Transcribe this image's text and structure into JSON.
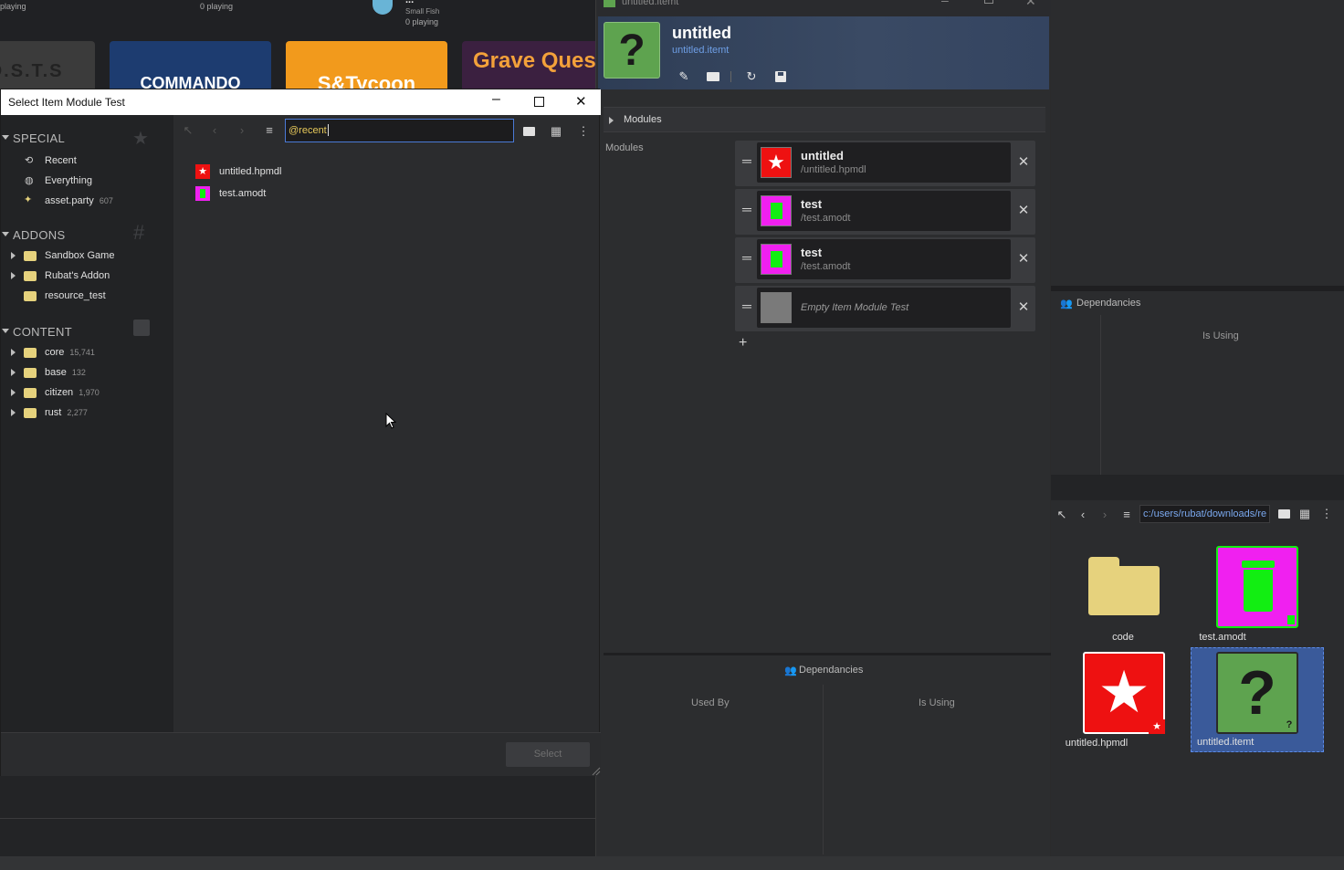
{
  "game_browser": {
    "playing_left": "playing",
    "playing_mid": "0 playing",
    "featured_title": "...",
    "featured_author": "Small Fish",
    "featured_players": "0 playing",
    "cards": [
      "G.O.S.T.S",
      "COMMANDO",
      "S&Tycoon",
      "Grave Ques"
    ]
  },
  "item_editor": {
    "window_title": "untitled.itemt",
    "asset_name": "untitled",
    "asset_path": "untitled.itemt",
    "toolbar": [
      "pencil-icon",
      "folder-icon",
      "refresh-icon",
      "save-icon"
    ],
    "modules_section": "Modules",
    "modules_label": "Modules",
    "modules": [
      {
        "title": "untitled",
        "sub": "/untitled.hpmdl",
        "thumb": "star"
      },
      {
        "title": "test",
        "sub": "/test.amodt",
        "thumb": "trash"
      },
      {
        "title": "test",
        "sub": "/test.amodt",
        "thumb": "trash"
      },
      {
        "title": "Empty Item Module Test",
        "sub": "",
        "thumb": "empty"
      }
    ],
    "add_symbol": "+",
    "dependencies": {
      "title": "Dependancies",
      "used_by": "Used By",
      "is_using": "Is Using"
    }
  },
  "right_panel": {
    "dependencies": {
      "title": "Dependancies",
      "is_using": "Is Using"
    },
    "path": "c:/users/rubat/downloads/re",
    "tiles": [
      {
        "label": "code",
        "kind": "folder"
      },
      {
        "label": "test.amodt",
        "kind": "trash"
      },
      {
        "label": "untitled.hpmdl",
        "kind": "star"
      },
      {
        "label": "untitled.itemt",
        "kind": "question"
      }
    ]
  },
  "dialog": {
    "title": "Select Item Module Test",
    "search_value": "@recent",
    "sections": {
      "special": {
        "heading": "SPECIAL",
        "items": [
          {
            "label": "Recent",
            "count": ""
          },
          {
            "label": "Everything",
            "count": ""
          },
          {
            "label": "asset.party",
            "count": "607"
          }
        ]
      },
      "addons": {
        "heading": "ADDONS",
        "items": [
          {
            "label": "Sandbox Game"
          },
          {
            "label": "Rubat's Addon"
          },
          {
            "label": "resource_test"
          }
        ]
      },
      "content": {
        "heading": "CONTENT",
        "items": [
          {
            "label": "core",
            "count": "15,741"
          },
          {
            "label": "base",
            "count": "132"
          },
          {
            "label": "citizen",
            "count": "1,970"
          },
          {
            "label": "rust",
            "count": "2,277"
          }
        ]
      }
    },
    "files": [
      {
        "name": "untitled.hpmdl",
        "kind": "star"
      },
      {
        "name": "test.amodt",
        "kind": "trash"
      }
    ],
    "select_label": "Select"
  },
  "colors": {
    "accent_blue": "#3a6fd8",
    "star_red": "#ee1111",
    "trash_magenta": "#f020f0",
    "green": "#12ee12",
    "question_green": "#5ea34f"
  }
}
